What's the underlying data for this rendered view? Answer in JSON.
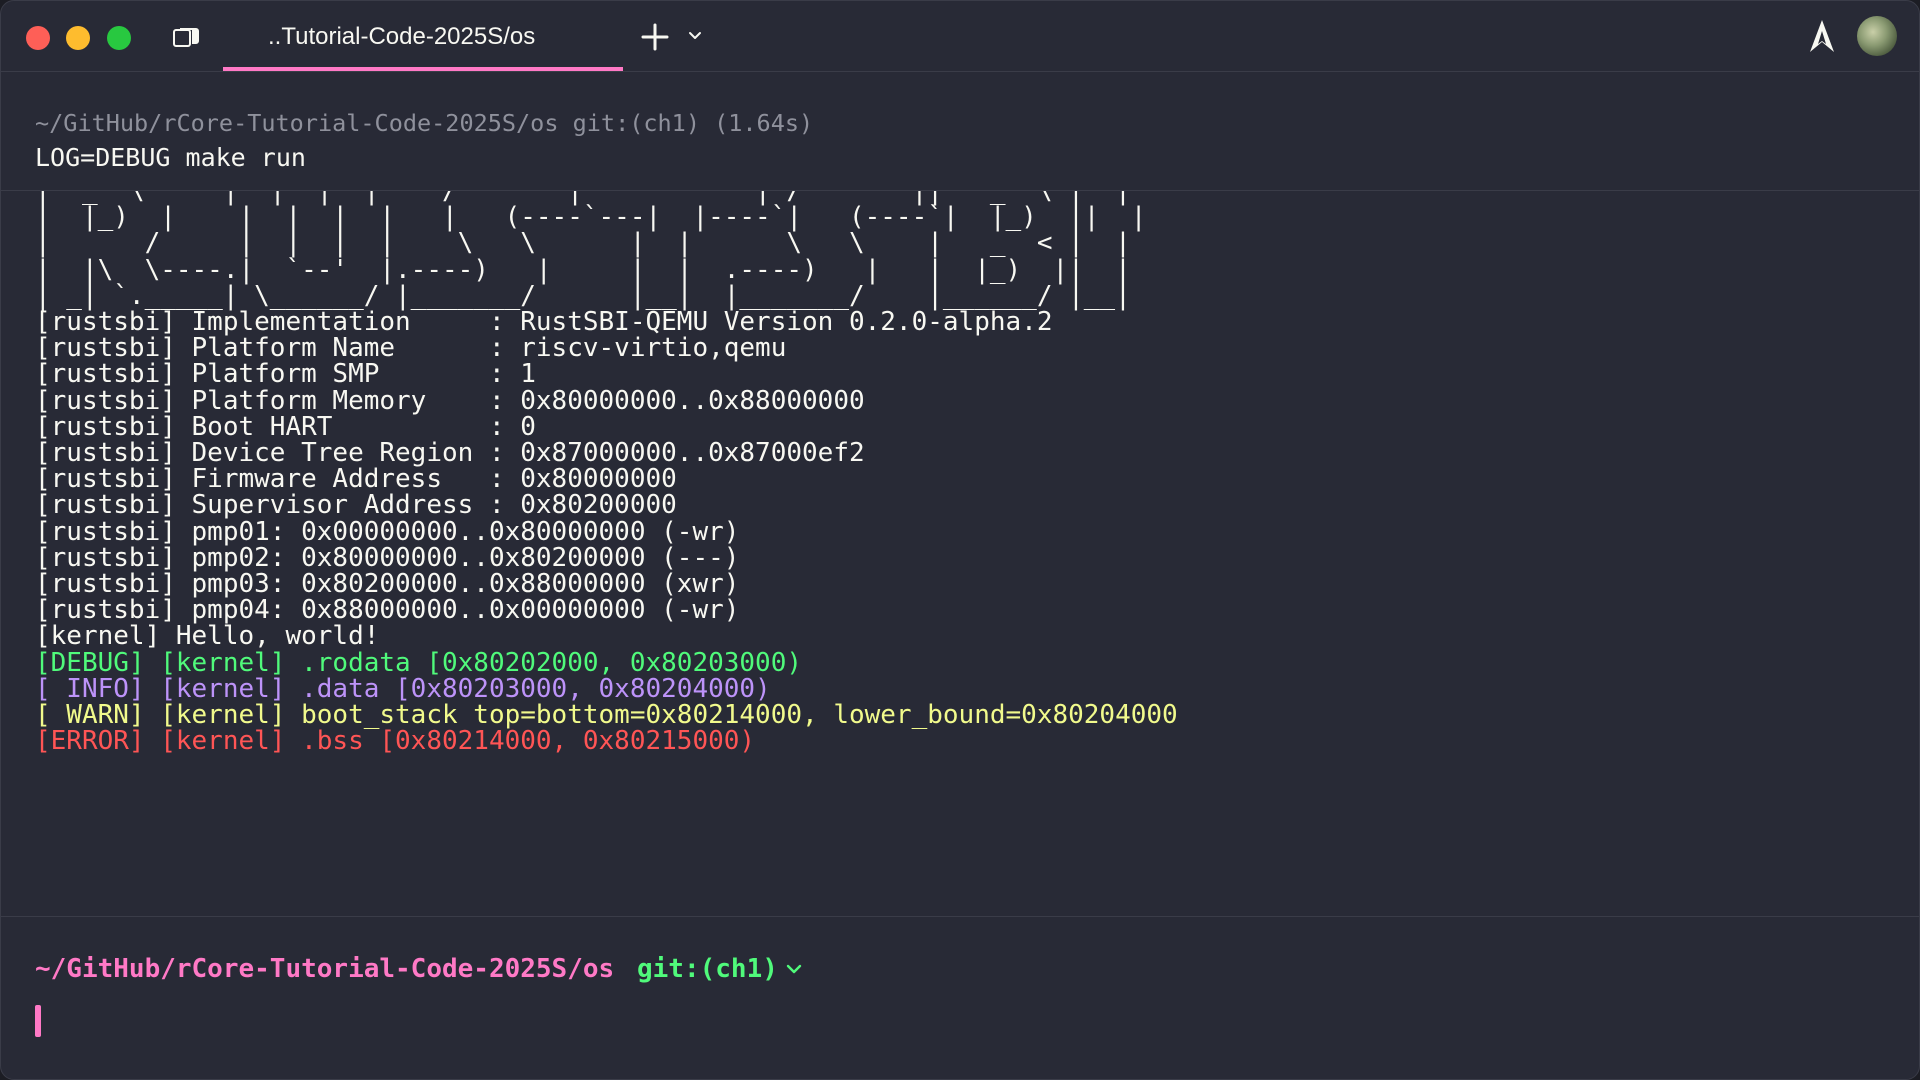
{
  "window": {
    "tab_title": "..Tutorial-Code-2025S/os"
  },
  "block": {
    "prompt": "~/GitHub/rCore-Tutorial-Code-2025S/os git:(ch1) (1.64s)",
    "command": "LOG=DEBUG make run"
  },
  "output": {
    "lines": [
      {
        "text": "|  _  \\     |  |  |  |    /       |           | /       ||   _  \\ |  |",
        "style": "default"
      },
      {
        "text": "|  |_)  |    |  |  |  |   |   (----`---|  |----`|   (----`|  |_)  ||  |",
        "style": "default"
      },
      {
        "text": "|      /     |  |  |  |    \\   \\      |  |      \\   \\    |   _  < |  |",
        "style": "default"
      },
      {
        "text": "|  |\\  \\----.|  `--'  |.----)   |     |  |  .----)   |   |  |_)  ||  |",
        "style": "default"
      },
      {
        "text": "| _| `._____| \\______/ |_______/      |__|  |_______/    |______/ |__|",
        "style": "default"
      },
      {
        "text": "[rustsbi] Implementation     : RustSBI-QEMU Version 0.2.0-alpha.2",
        "style": "default"
      },
      {
        "text": "[rustsbi] Platform Name      : riscv-virtio,qemu",
        "style": "default"
      },
      {
        "text": "[rustsbi] Platform SMP       : 1",
        "style": "default"
      },
      {
        "text": "[rustsbi] Platform Memory    : 0x80000000..0x88000000",
        "style": "default"
      },
      {
        "text": "[rustsbi] Boot HART          : 0",
        "style": "default"
      },
      {
        "text": "[rustsbi] Device Tree Region : 0x87000000..0x87000ef2",
        "style": "default"
      },
      {
        "text": "[rustsbi] Firmware Address   : 0x80000000",
        "style": "default"
      },
      {
        "text": "[rustsbi] Supervisor Address : 0x80200000",
        "style": "default"
      },
      {
        "text": "[rustsbi] pmp01: 0x00000000..0x80000000 (-wr)",
        "style": "default"
      },
      {
        "text": "[rustsbi] pmp02: 0x80000000..0x80200000 (---)",
        "style": "default"
      },
      {
        "text": "[rustsbi] pmp03: 0x80200000..0x88000000 (xwr)",
        "style": "default"
      },
      {
        "text": "[rustsbi] pmp04: 0x88000000..0x00000000 (-wr)",
        "style": "default"
      },
      {
        "text": "[kernel] Hello, world!",
        "style": "default"
      },
      {
        "text": "[DEBUG] [kernel] .rodata [0x80202000, 0x80203000)",
        "style": "debug"
      },
      {
        "text": "[ INFO] [kernel] .data [0x80203000, 0x80204000)",
        "style": "info"
      },
      {
        "text": "[ WARN] [kernel] boot_stack top=bottom=0x80214000, lower_bound=0x80204000",
        "style": "warn"
      },
      {
        "text": "[ERROR] [kernel] .bss [0x80214000, 0x80215000)",
        "style": "error"
      }
    ]
  },
  "input": {
    "path": "~/GitHub/rCore-Tutorial-Code-2025S/os",
    "git": "git:(ch1)"
  },
  "icons": {
    "sidebar_toggle": "sidebar-toggle-icon",
    "new_tab": "plus-icon",
    "tab_menu": "chevron-down-icon",
    "app_logo": "warp-logo-icon",
    "avatar": "avatar",
    "git_chevron": "chevron-down-icon"
  },
  "colors": {
    "background": "#282a36",
    "foreground": "#f8f8f2",
    "accent": "#ff79c6",
    "debug": "#50fa7b",
    "info": "#bd93f9",
    "warn": "#f1fa8c",
    "error": "#ff5555"
  }
}
